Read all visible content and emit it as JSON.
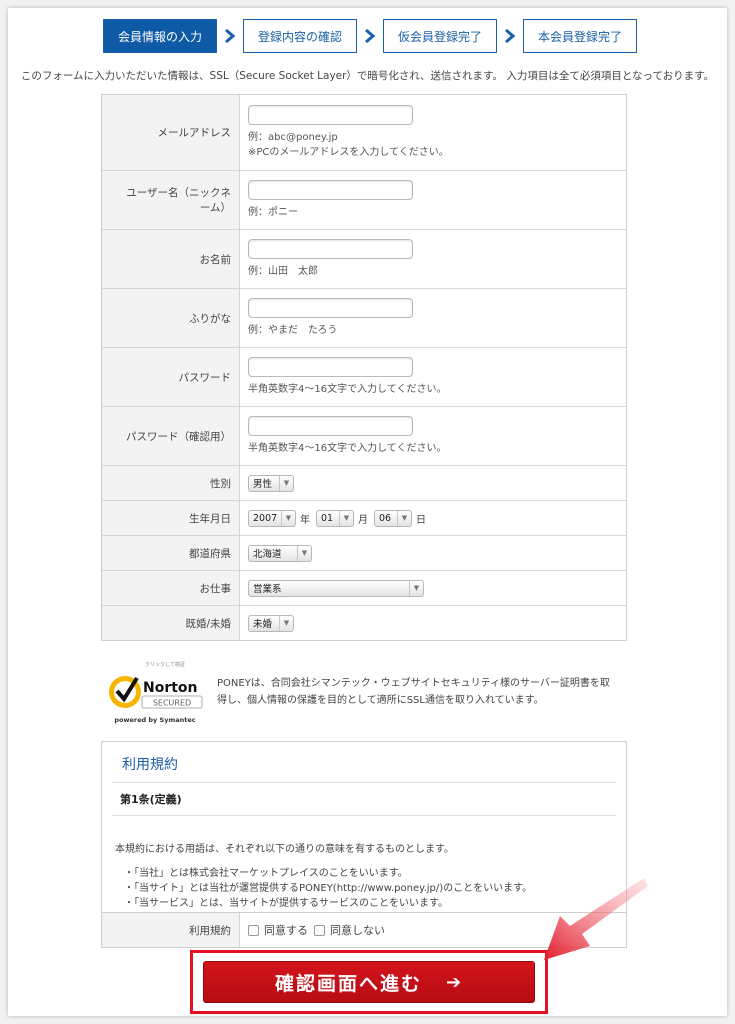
{
  "steps": [
    {
      "label": "会員情報の入力",
      "active": true
    },
    {
      "label": "登録内容の確認",
      "active": false
    },
    {
      "label": "仮会員登録完了",
      "active": false
    },
    {
      "label": "本会員登録完了",
      "active": false
    }
  ],
  "notice": "このフォームに入力いただいた情報は、SSL（Secure Socket Layer）で暗号化され、送信されます。 入力項目は全て必須項目となっております。",
  "form": {
    "email": {
      "label": "メールアドレス",
      "hint1": "例：abc@poney.jp",
      "hint2": "※PCのメールアドレスを入力してください。"
    },
    "username": {
      "label": "ユーザー名（ニックネーム）",
      "hint": "例：ポニー"
    },
    "name": {
      "label": "お名前",
      "hint": "例：山田　太郎"
    },
    "furigana": {
      "label": "ふりがな",
      "hint": "例：やまだ　たろう"
    },
    "password": {
      "label": "パスワード",
      "hint": "半角英数字4〜16文字で入力してください。"
    },
    "password_confirm": {
      "label": "パスワード（確認用）",
      "hint": "半角英数字4〜16文字で入力してください。"
    },
    "gender": {
      "label": "性別",
      "value": "男性"
    },
    "birthday": {
      "label": "生年月日",
      "year": "2007",
      "year_unit": "年",
      "month": "01",
      "month_unit": "月",
      "day": "06",
      "day_unit": "日"
    },
    "prefecture": {
      "label": "都道府県",
      "value": "北海道"
    },
    "job": {
      "label": "お仕事",
      "value": "営業系"
    },
    "marital": {
      "label": "既婚/未婚",
      "value": "未婚"
    }
  },
  "norton": {
    "small_text": "クリックして検証",
    "brand": "Norton",
    "secured": "SECURED",
    "powered": "powered by Symantec",
    "description": "PONEYは、合同会社シマンテック・ウェブサイトセキュリティ様のサーバー証明書を取得し、個人情報の保護を目的として適所にSSL通信を取り入れています。"
  },
  "terms": {
    "title": "利用規約",
    "article": "第1条(定義)",
    "body": "本規約における用語は、それぞれ以下の通りの意味を有するものとします。",
    "items": [
      "・「当社」とは株式会社マーケットプレイスのことをいいます。",
      "・「当サイト」とは当社が運営提供するPONEY(http://www.poney.jp/)のことをいいます。",
      "・「当サービス」とは、当サイトが提供するサービスのことをいいます。"
    ],
    "agree_label": "利用規約",
    "agree": "同意する",
    "disagree": "同意しない"
  },
  "submit": {
    "label": "確認画面へ進む",
    "arrow": "➔"
  },
  "colors": {
    "primary": "#0e5aa7",
    "submit": "#c8101a",
    "highlight": "#e30f22"
  }
}
